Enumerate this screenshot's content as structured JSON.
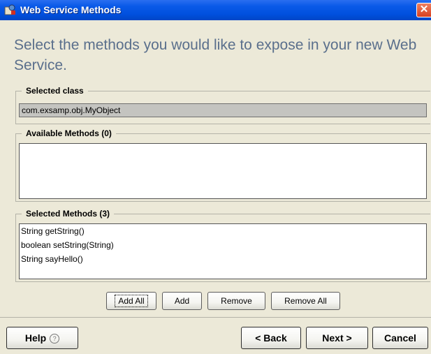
{
  "window": {
    "title": "Web Service Methods",
    "close_glyph": "✕",
    "icon": "app-icon"
  },
  "heading": "Select the methods you would like to expose in your new Web Service.",
  "selected_class": {
    "legend": "Selected class",
    "value": "com.exsamp.obj.MyObject"
  },
  "available_methods": {
    "legend": "Available Methods (0)",
    "items": []
  },
  "selected_methods": {
    "legend": "Selected Methods (3)",
    "items": [
      "String getString()",
      "boolean setString(String)",
      "String sayHello()"
    ]
  },
  "actions": {
    "add_all": "Add All",
    "add": "Add",
    "remove": "Remove",
    "remove_all": "Remove All"
  },
  "footer": {
    "help": "Help",
    "help_icon": "?",
    "back": "< Back",
    "next": "Next >",
    "cancel": "Cancel"
  },
  "colors": {
    "titlebar": "#0a5ae8",
    "heading": "#5a6f8c",
    "background": "#ece9d8"
  }
}
